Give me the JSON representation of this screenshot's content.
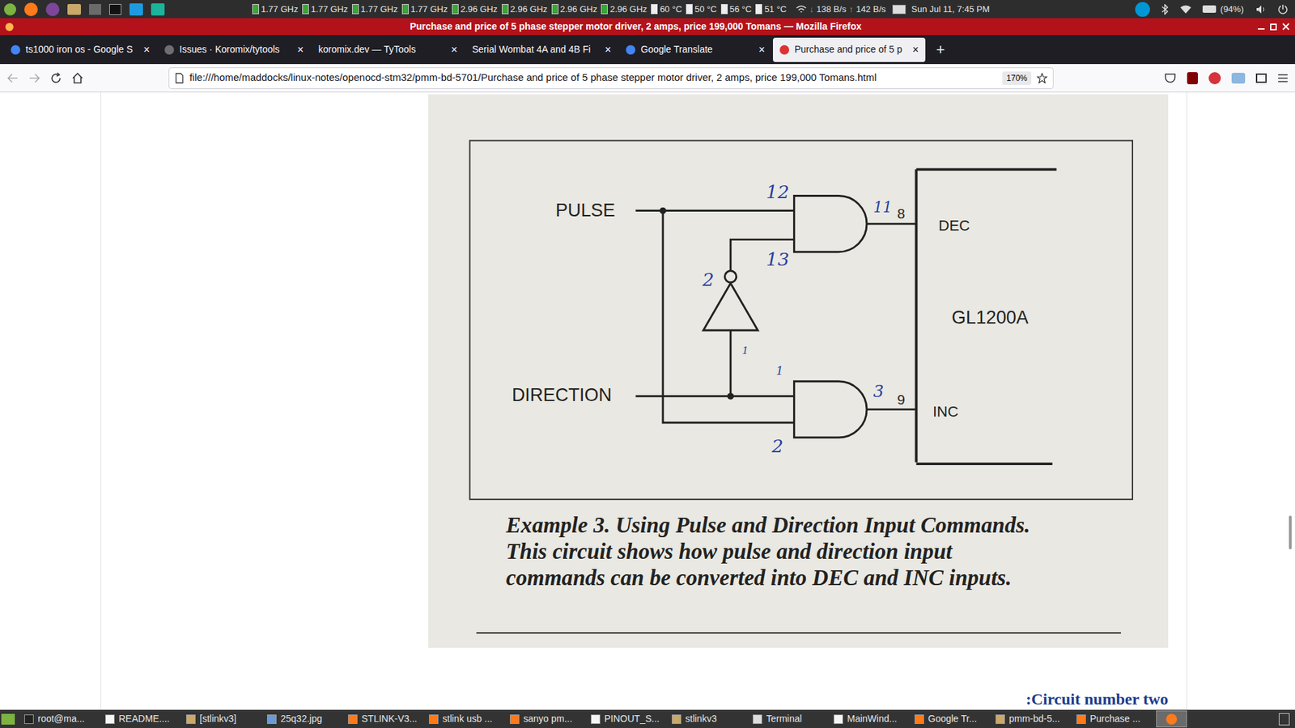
{
  "top_panel": {
    "cpu_frequencies": [
      "1.77 GHz",
      "1.77 GHz",
      "1.77 GHz",
      "1.77 GHz",
      "2.96 GHz",
      "2.96 GHz",
      "2.96 GHz",
      "2.96 GHz"
    ],
    "temperatures": [
      "60 °C",
      "50 °C",
      "56 °C",
      "51 °C"
    ],
    "net_down": "138 B/s",
    "net_up": "142 B/s",
    "clock": "Sun Jul 11, 7:45 PM",
    "battery": "(94%)"
  },
  "window": {
    "title": "Purchase and price of 5 phase stepper motor driver, 2 amps, price 199,000 Tomans — Mozilla Firefox"
  },
  "tabs": [
    {
      "label": "ts1000 iron os - Google S",
      "selected": false
    },
    {
      "label": "Issues · Koromix/tytools",
      "selected": false
    },
    {
      "label": "koromix.dev — TyTools",
      "selected": false
    },
    {
      "label": "Serial Wombat 4A and 4B Fi",
      "selected": false
    },
    {
      "label": "Google Translate",
      "selected": false
    },
    {
      "label": "Purchase and price of 5 p",
      "selected": true
    }
  ],
  "tab_close": "×",
  "new_tab": "+",
  "address_bar": {
    "url": "file:///home/maddocks/linux-notes/openocd-stm32/pmm-bd-5701/Purchase and price of 5 phase stepper motor driver, 2 amps, price 199,000 Tomans.html",
    "zoom": "170%"
  },
  "figure": {
    "pulse_label": "PULSE",
    "direction_label": "DIRECTION",
    "dec_label": "DEC",
    "inc_label": "INC",
    "chip_label": "GL1200A",
    "dec_pin": "8",
    "inc_pin": "9",
    "handwritten_pins": [
      "12",
      "11",
      "13",
      "2",
      "1",
      "1",
      "3",
      "2"
    ],
    "caption": [
      "Example 3. Using Pulse and Direction Input Commands.",
      "This circuit shows how pulse and direction input",
      "commands can be converted into DEC and INC inputs."
    ]
  },
  "section_heading": ":Circuit number two",
  "taskbar": {
    "items": [
      {
        "label": "root@ma...",
        "selected": false
      },
      {
        "label": "README....",
        "selected": false
      },
      {
        "label": "[stlinkv3]",
        "selected": false
      },
      {
        "label": "25q32.jpg",
        "selected": false
      },
      {
        "label": "STLINK-V3...",
        "selected": false
      },
      {
        "label": "stlink usb ...",
        "selected": false
      },
      {
        "label": "sanyo pm...",
        "selected": false
      },
      {
        "label": "PINOUT_S...",
        "selected": false
      },
      {
        "label": "stlinkv3",
        "selected": false
      },
      {
        "label": "Terminal",
        "selected": false
      },
      {
        "label": "MainWind...",
        "selected": false
      },
      {
        "label": "Google Tr...",
        "selected": false
      },
      {
        "label": "pmm-bd-5...",
        "selected": false
      },
      {
        "label": "Purchase ...",
        "selected": false
      }
    ],
    "active_button": {
      "selected": true
    }
  }
}
